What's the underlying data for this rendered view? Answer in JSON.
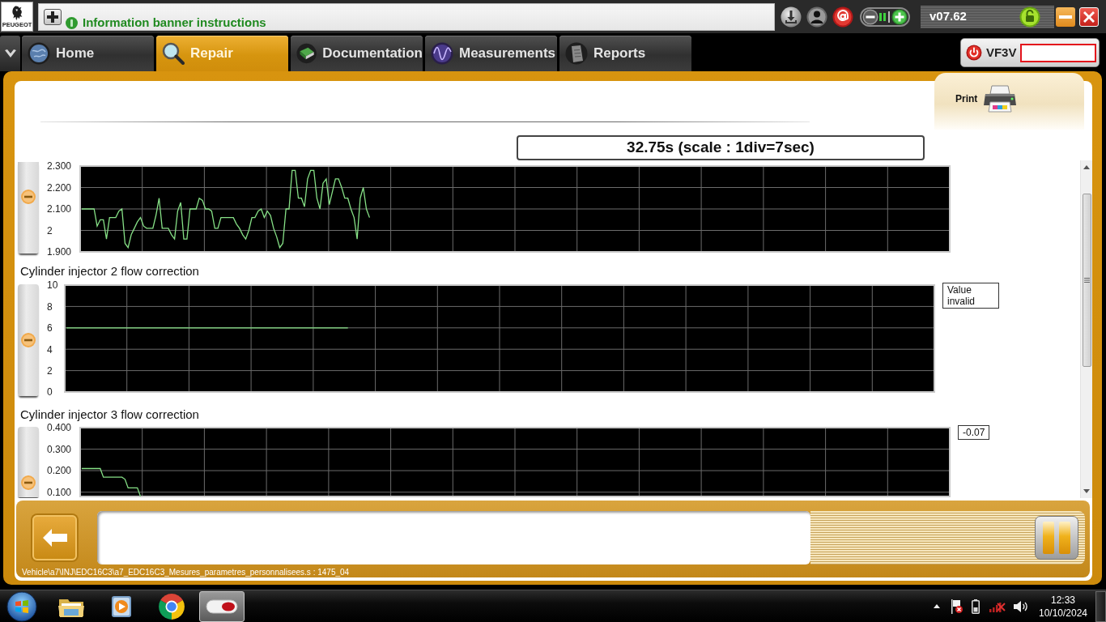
{
  "header": {
    "brand": "PEUGEOT",
    "banner": "Information banner instructions",
    "version": "v07.62"
  },
  "tabs": [
    {
      "label": "Home",
      "selected": false
    },
    {
      "label": "Repair",
      "selected": true
    },
    {
      "label": "Documentation",
      "selected": false
    },
    {
      "label": "Measurements",
      "selected": false
    },
    {
      "label": "Reports",
      "selected": false
    }
  ],
  "vehicle": {
    "vin": "VF3V"
  },
  "print": {
    "label": "Print"
  },
  "time_scale": "32.75s (scale : 1div=7sec)",
  "charts": [
    {
      "chart_data": {
        "type": "line",
        "grid": true,
        "ylim": [
          1.9,
          2.3
        ],
        "yticks": [
          {
            "value": 2.3,
            "label": "2.300"
          },
          {
            "value": 2.2,
            "label": "2.200"
          },
          {
            "value": 2.1,
            "label": "2.100"
          },
          {
            "value": 2,
            "label": "2"
          },
          {
            "value": 1.9,
            "label": "1.900"
          }
        ],
        "categories": [
          null,
          null,
          null,
          null,
          null,
          null,
          null,
          null,
          null,
          null,
          null,
          null,
          null,
          null,
          null,
          null,
          null,
          null,
          null,
          null,
          null,
          null,
          null,
          null,
          null,
          null,
          null,
          null,
          null,
          null,
          null,
          null,
          null,
          null,
          null,
          null,
          null,
          null,
          null,
          null,
          null,
          null,
          null,
          null,
          null,
          null,
          null,
          null,
          null,
          null,
          null,
          null,
          null,
          null,
          null,
          null,
          null,
          null,
          null,
          null,
          null,
          null,
          null,
          null,
          null,
          null,
          null,
          null,
          null,
          null,
          null,
          null,
          null,
          null,
          null,
          null,
          null,
          null,
          null,
          null,
          null,
          null,
          null,
          null,
          null,
          null,
          null,
          null,
          null,
          null,
          null,
          null,
          null,
          null,
          null,
          null,
          null,
          null,
          null,
          null,
          null,
          null,
          null,
          null,
          null,
          null,
          null,
          null,
          null,
          null,
          null,
          null,
          null,
          null,
          null,
          null,
          null,
          null,
          null,
          null,
          null,
          null,
          null,
          null,
          null,
          null,
          null,
          null,
          null,
          null,
          null,
          null,
          null,
          null,
          null,
          null,
          null,
          null,
          null,
          null,
          null,
          null,
          null,
          null,
          null,
          null,
          null,
          null,
          null,
          null,
          null,
          null,
          null,
          null,
          null,
          null,
          null,
          null,
          null,
          null,
          null,
          null,
          null,
          null,
          null,
          null,
          null,
          null,
          null,
          null,
          null,
          null,
          null,
          null,
          null,
          null,
          null,
          null,
          null,
          null,
          null,
          null,
          null,
          null,
          null,
          null,
          null,
          null,
          null,
          null,
          null,
          null,
          null,
          null,
          null,
          null,
          null,
          null,
          null,
          null,
          null,
          null,
          null,
          null,
          null,
          null,
          null,
          null,
          null,
          null,
          null,
          null,
          null,
          null,
          null,
          null,
          null,
          null,
          null,
          null,
          null,
          null,
          null,
          null,
          null,
          null,
          null,
          null,
          null,
          null,
          null,
          null,
          null,
          null,
          null,
          null,
          null,
          null,
          null,
          null,
          null,
          null,
          null,
          null,
          null,
          null,
          null,
          null,
          null,
          null,
          null,
          null,
          null,
          null,
          null,
          null,
          null,
          null,
          null,
          null,
          null,
          null,
          null,
          null,
          null,
          null,
          null,
          null,
          null,
          null,
          null,
          null,
          null,
          null,
          null,
          null,
          null,
          null,
          null,
          null,
          null
        ],
        "values": [
          2.1,
          2.1,
          2.1,
          2.1,
          2.1,
          2.02,
          2.05,
          2.05,
          1.96,
          2.06,
          2.06,
          2.06,
          2.09,
          2.1,
          1.94,
          1.92,
          1.98,
          2.01,
          2.04,
          2.06,
          2.02,
          2.01,
          2.01,
          2.01,
          2.07,
          2.15,
          2.01,
          2.01,
          2.01,
          1.98,
          1.96,
          2.09,
          2.13,
          1.96,
          1.96,
          2.1,
          2.1,
          2.1,
          2.15,
          2.14,
          2.1,
          2.1,
          2.09,
          2.01,
          2.01,
          2.06,
          2.06,
          2.06,
          2.06,
          2.06,
          2.03,
          2.01,
          1.98,
          1.96,
          2,
          2.06,
          2.06,
          2.09,
          2.1,
          2.06,
          2.09,
          2.07,
          2.01,
          1.97,
          1.92,
          1.94,
          2.1,
          2.1,
          2.28,
          2.28,
          2.15,
          2.15,
          2.11,
          2.24,
          2.28,
          2.28,
          2.15,
          2.1,
          2.22,
          2.24,
          2.12,
          2.18,
          2.24,
          2.24,
          2.2,
          2.15,
          2.15,
          2.1,
          2.06,
          1.96,
          2.15,
          2.2,
          2.1,
          2.06,
          null,
          null,
          null,
          null,
          null,
          null,
          null,
          null,
          null,
          null,
          null,
          null,
          null,
          null,
          null,
          null,
          null,
          null,
          null,
          null,
          null,
          null,
          null,
          null,
          null,
          null,
          null,
          null,
          null,
          null,
          null,
          null,
          null,
          null,
          null,
          null,
          null,
          null,
          null,
          null,
          null,
          null,
          null,
          null,
          null,
          null,
          null,
          null,
          null,
          null,
          null,
          null,
          null,
          null,
          null,
          null,
          null,
          null,
          null,
          null,
          null,
          null,
          null,
          null,
          null,
          null,
          null,
          null,
          null,
          null,
          null,
          null,
          null,
          null,
          null,
          null,
          null,
          null,
          null,
          null,
          null,
          null,
          null,
          null,
          null,
          null,
          null,
          null,
          null,
          null,
          null,
          null,
          null,
          null,
          null,
          null,
          null,
          null,
          null,
          null,
          null,
          null,
          null,
          null,
          null,
          null,
          null,
          null,
          null,
          null,
          null,
          null,
          null,
          null,
          null,
          null,
          null,
          null,
          null,
          null,
          null,
          null,
          null,
          null,
          null,
          null,
          null,
          null,
          null,
          null,
          null,
          null,
          null,
          null,
          null,
          null,
          null,
          null,
          null,
          null,
          null,
          null,
          null,
          null,
          null,
          null,
          null,
          null,
          null,
          null,
          null,
          null,
          null,
          null,
          null,
          null,
          null,
          null,
          null,
          null,
          null,
          null,
          null,
          null,
          null,
          null,
          null,
          null,
          null,
          null,
          null,
          null,
          null,
          null,
          null,
          null,
          null,
          null,
          null,
          null,
          null,
          null,
          null,
          null,
          null,
          null,
          null
        ]
      }
    },
    {
      "reading": "Value invalid",
      "chart_data": {
        "type": "line",
        "grid": true,
        "title": "Cylinder injector 2 flow correction",
        "ylim": [
          0,
          10
        ],
        "yticks": [
          {
            "value": 10,
            "label": "10"
          },
          {
            "value": 8,
            "label": "8"
          },
          {
            "value": 6,
            "label": "6"
          },
          {
            "value": 4,
            "label": "4"
          },
          {
            "value": 2,
            "label": "2"
          },
          {
            "value": 0,
            "label": "0"
          }
        ],
        "categories": [
          null,
          null,
          null,
          null,
          null,
          null,
          null,
          null,
          null,
          null,
          null,
          null,
          null,
          null,
          null,
          null,
          null,
          null,
          null,
          null,
          null,
          null,
          null,
          null,
          null,
          null,
          null,
          null,
          null,
          null,
          null,
          null,
          null,
          null,
          null,
          null,
          null,
          null,
          null,
          null,
          null,
          null,
          null,
          null,
          null,
          null,
          null,
          null,
          null,
          null,
          null,
          null,
          null,
          null,
          null,
          null,
          null,
          null,
          null,
          null,
          null,
          null,
          null,
          null,
          null,
          null,
          null,
          null,
          null,
          null,
          null,
          null,
          null,
          null,
          null,
          null,
          null,
          null,
          null,
          null,
          null,
          null,
          null,
          null,
          null,
          null,
          null,
          null,
          null,
          null,
          null,
          null,
          null,
          null,
          null,
          null,
          null,
          null,
          null,
          null,
          null,
          null,
          null,
          null,
          null,
          null,
          null,
          null,
          null,
          null,
          null,
          null,
          null,
          null,
          null,
          null,
          null,
          null,
          null,
          null,
          null,
          null,
          null,
          null,
          null,
          null,
          null,
          null,
          null,
          null,
          null,
          null,
          null,
          null,
          null,
          null,
          null,
          null,
          null,
          null,
          null,
          null,
          null,
          null,
          null,
          null,
          null,
          null,
          null,
          null,
          null,
          null,
          null,
          null,
          null,
          null,
          null,
          null,
          null,
          null,
          null,
          null,
          null,
          null,
          null,
          null,
          null,
          null,
          null,
          null,
          null,
          null,
          null,
          null,
          null,
          null,
          null,
          null,
          null,
          null,
          null,
          null,
          null,
          null,
          null,
          null,
          null,
          null,
          null,
          null,
          null,
          null,
          null,
          null,
          null,
          null,
          null,
          null,
          null,
          null,
          null,
          null,
          null,
          null,
          null,
          null,
          null,
          null,
          null,
          null,
          null,
          null,
          null,
          null,
          null,
          null,
          null,
          null,
          null,
          null,
          null,
          null,
          null,
          null,
          null,
          null,
          null,
          null,
          null,
          null,
          null,
          null,
          null,
          null,
          null,
          null,
          null,
          null,
          null,
          null,
          null,
          null,
          null,
          null,
          null,
          null,
          null,
          null,
          null,
          null,
          null,
          null,
          null,
          null,
          null,
          null,
          null,
          null,
          null,
          null,
          null,
          null,
          null,
          null,
          null,
          null,
          null,
          null,
          null,
          null,
          null,
          null,
          null,
          null,
          null,
          null,
          null,
          null,
          null,
          null,
          null
        ],
        "values": [
          6,
          6,
          6,
          6,
          6,
          6,
          6,
          6,
          6,
          6,
          6,
          6,
          6,
          6,
          6,
          6,
          6,
          6,
          6,
          6,
          6,
          6,
          6,
          6,
          6,
          6,
          6,
          6,
          6,
          6,
          6,
          6,
          6,
          6,
          6,
          6,
          6,
          6,
          6,
          6,
          6,
          6,
          6,
          6,
          6,
          6,
          6,
          6,
          6,
          6,
          6,
          6,
          6,
          6,
          6,
          6,
          6,
          6,
          6,
          6,
          6,
          6,
          6,
          6,
          6,
          6,
          6,
          6,
          6,
          6,
          6,
          6,
          6,
          6,
          6,
          6,
          6,
          6,
          6,
          6,
          6,
          6,
          6,
          6,
          6,
          6,
          6,
          6,
          6,
          6,
          6,
          6,
          null,
          null,
          null,
          null,
          null,
          null,
          null,
          null,
          null,
          null,
          null,
          null,
          null,
          null,
          null,
          null,
          null,
          null,
          null,
          null,
          null,
          null,
          null,
          null,
          null,
          null,
          null,
          null,
          null,
          null,
          null,
          null,
          null,
          null,
          null,
          null,
          null,
          null,
          null,
          null,
          null,
          null,
          null,
          null,
          null,
          null,
          null,
          null,
          null,
          null,
          null,
          null,
          null,
          null,
          null,
          null,
          null,
          null,
          null,
          null,
          null,
          null,
          null,
          null,
          null,
          null,
          null,
          null,
          null,
          null,
          null,
          null,
          null,
          null,
          null,
          null,
          null,
          null,
          null,
          null,
          null,
          null,
          null,
          null,
          null,
          null,
          null,
          null,
          null,
          null,
          null,
          null,
          null,
          null,
          null,
          null,
          null,
          null,
          null,
          null,
          null,
          null,
          null,
          null,
          null,
          null,
          null,
          null,
          null,
          null,
          null,
          null,
          null,
          null,
          null,
          null,
          null,
          null,
          null,
          null,
          null,
          null,
          null,
          null,
          null,
          null,
          null,
          null,
          null,
          null,
          null,
          null,
          null,
          null,
          null,
          null,
          null,
          null,
          null,
          null,
          null,
          null,
          null,
          null,
          null,
          null,
          null,
          null,
          null,
          null,
          null,
          null,
          null,
          null,
          null,
          null,
          null,
          null,
          null,
          null,
          null,
          null,
          null,
          null,
          null,
          null,
          null,
          null,
          null,
          null,
          null,
          null,
          null,
          null,
          null,
          null,
          null,
          null,
          null,
          null,
          null,
          null,
          null,
          null,
          null,
          null,
          null,
          null,
          null
        ]
      }
    },
    {
      "reading": "-0.07",
      "chart_data": {
        "type": "line",
        "grid": true,
        "title": "Cylinder injector 3 flow correction",
        "ylim": [
          0.08,
          0.4
        ],
        "yticks": [
          {
            "value": 0.4,
            "label": "0.400"
          },
          {
            "value": 0.3,
            "label": "0.300"
          },
          {
            "value": 0.2,
            "label": "0.200"
          },
          {
            "value": 0.1,
            "label": "0.100"
          }
        ],
        "categories": [
          null,
          null,
          null,
          null,
          null,
          null,
          null,
          null,
          null,
          null,
          null,
          null,
          null,
          null,
          null,
          null,
          null,
          null,
          null,
          null,
          null,
          null,
          null,
          null,
          null,
          null,
          null,
          null,
          null,
          null,
          null,
          null,
          null,
          null,
          null,
          null,
          null,
          null,
          null,
          null,
          null,
          null,
          null,
          null,
          null,
          null,
          null,
          null,
          null,
          null,
          null,
          null,
          null,
          null,
          null,
          null,
          null,
          null,
          null,
          null,
          null,
          null,
          null,
          null,
          null,
          null,
          null,
          null,
          null,
          null,
          null,
          null,
          null,
          null,
          null,
          null,
          null,
          null,
          null,
          null,
          null,
          null,
          null,
          null,
          null,
          null,
          null,
          null,
          null,
          null,
          null,
          null,
          null,
          null,
          null,
          null,
          null,
          null,
          null,
          null,
          null,
          null,
          null,
          null,
          null,
          null,
          null,
          null,
          null,
          null,
          null,
          null,
          null,
          null,
          null,
          null,
          null,
          null,
          null,
          null,
          null,
          null,
          null,
          null,
          null,
          null,
          null,
          null,
          null,
          null,
          null,
          null,
          null,
          null,
          null,
          null,
          null,
          null,
          null,
          null,
          null,
          null,
          null,
          null,
          null,
          null,
          null,
          null,
          null,
          null,
          null,
          null,
          null,
          null,
          null,
          null,
          null,
          null,
          null,
          null,
          null,
          null,
          null,
          null,
          null,
          null,
          null,
          null,
          null,
          null,
          null,
          null,
          null,
          null,
          null,
          null,
          null,
          null,
          null,
          null,
          null,
          null,
          null,
          null,
          null,
          null,
          null,
          null,
          null,
          null,
          null,
          null,
          null,
          null,
          null,
          null,
          null,
          null,
          null,
          null,
          null,
          null,
          null,
          null,
          null,
          null,
          null,
          null,
          null,
          null,
          null,
          null,
          null,
          null,
          null,
          null,
          null,
          null,
          null,
          null,
          null,
          null,
          null,
          null,
          null,
          null,
          null,
          null,
          null,
          null,
          null,
          null,
          null,
          null,
          null,
          null,
          null,
          null,
          null,
          null,
          null,
          null,
          null,
          null,
          null,
          null,
          null,
          null,
          null,
          null,
          null,
          null,
          null,
          null,
          null,
          null,
          null,
          null,
          null,
          null,
          null,
          null,
          null,
          null,
          null,
          null,
          null,
          null,
          null,
          null,
          null,
          null,
          null,
          null,
          null,
          null,
          null,
          null,
          null,
          null,
          null
        ],
        "values": [
          0.21,
          0.21,
          0.21,
          0.21,
          0.21,
          0.21,
          0.21,
          0.17,
          0.17,
          0.17,
          0.17,
          0.17,
          0.17,
          0.17,
          0.16,
          0.12,
          0.12,
          0.12,
          0.12,
          0.08,
          null,
          null,
          null,
          null,
          null,
          null,
          null,
          null,
          null,
          null,
          null,
          null,
          null,
          null,
          null,
          null,
          null,
          null,
          null,
          null,
          null,
          null,
          null,
          null,
          null,
          null,
          null,
          null,
          null,
          null,
          null,
          null,
          null,
          null,
          null,
          null,
          null,
          null,
          null,
          null,
          null,
          null,
          null,
          null,
          null,
          null,
          null,
          null,
          null,
          null,
          null,
          null,
          null,
          null,
          null,
          null,
          null,
          null,
          null,
          null,
          null,
          null,
          null,
          null,
          null,
          null,
          null,
          null,
          null,
          null,
          null,
          null,
          null,
          null,
          null,
          null,
          null,
          null,
          null,
          null,
          null,
          null,
          null,
          null,
          null,
          null,
          null,
          null,
          null,
          null,
          null,
          null,
          null,
          null,
          null,
          null,
          null,
          null,
          null,
          null,
          null,
          null,
          null,
          null,
          null,
          null,
          null,
          null,
          null,
          null,
          null,
          null,
          null,
          null,
          null,
          null,
          null,
          null,
          null,
          null,
          null,
          null,
          null,
          null,
          null,
          null,
          null,
          null,
          null,
          null,
          null,
          null,
          null,
          null,
          null,
          null,
          null,
          null,
          null,
          null,
          null,
          null,
          null,
          null,
          null,
          null,
          null,
          null,
          null,
          null,
          null,
          null,
          null,
          null,
          null,
          null,
          null,
          null,
          null,
          null,
          null,
          null,
          null,
          null,
          null,
          null,
          null,
          null,
          null,
          null,
          null,
          null,
          null,
          null,
          null,
          null,
          null,
          null,
          null,
          null,
          null,
          null,
          null,
          null,
          null,
          null,
          null,
          null,
          null,
          null,
          null,
          null,
          null,
          null,
          null,
          null,
          null,
          null,
          null,
          null,
          null,
          null,
          null,
          null,
          null,
          null,
          null,
          null,
          null,
          null,
          null,
          null,
          null,
          null,
          null,
          null,
          null,
          null,
          null,
          null,
          null,
          null,
          null,
          null,
          null,
          null,
          null,
          null,
          null,
          null,
          null,
          null,
          null,
          null,
          null,
          null,
          null,
          null,
          null,
          null,
          null,
          null,
          null,
          null,
          null,
          null,
          null,
          null,
          null,
          null,
          null,
          null,
          null,
          null,
          null,
          null,
          null,
          null,
          null,
          null,
          null
        ]
      }
    }
  ],
  "status_path": "Vehicle\\a7\\INJ\\EDC16C3\\a7_EDC16C3_Mesures_parametres_personnalisees.s : 1475_04",
  "taskbar": {
    "apps": [
      {
        "selected": false
      },
      {
        "selected": false
      },
      {
        "selected": false
      },
      {
        "selected": true
      }
    ],
    "time": "12:33",
    "date": "10/10/2024"
  }
}
